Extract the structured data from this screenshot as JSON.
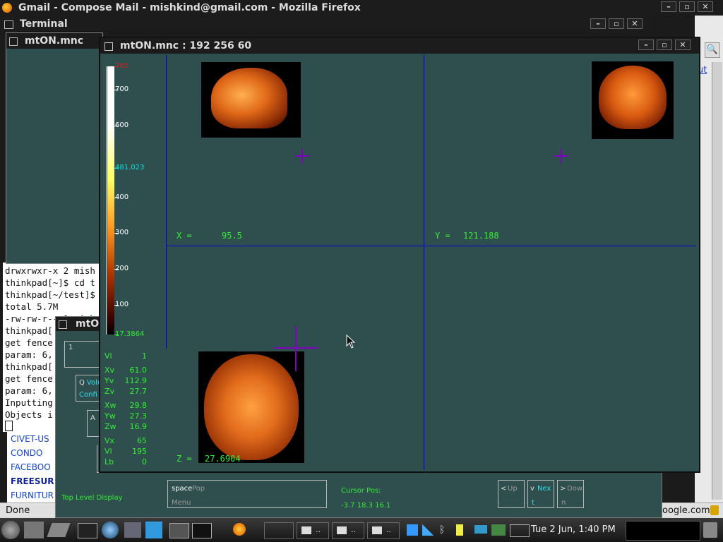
{
  "firefox": {
    "title": "Gmail - Compose Mail - mishkind@gmail.com - Mozilla Firefox",
    "status": "Done",
    "status_right": "oogle.com",
    "link_right": "ut",
    "bookmarks": [
      "CIVET-US",
      "CONDO",
      "FACEBOO",
      "FREESUR",
      "FURNITUR"
    ]
  },
  "terminal": {
    "title": "Terminal",
    "lines": [
      "drwxrwxr-x 2 mish",
      "thinkpad[~]$ cd t",
      "thinkpad[~/test]$",
      "total 5.7M",
      "-rw-rw-r-- 1 mish",
      "thinkpad[",
      "get fence",
      "param: 6,",
      "thinkpad[",
      "get fence",
      "param: 6,",
      "Inputting",
      "Objects i"
    ]
  },
  "mtonsmall": {
    "title": "mtON.mnc"
  },
  "mtonmenu": {
    "title": "mtO",
    "field1": "1",
    "btn_q": "Q",
    "btn_q_label": "Volu",
    "btn_conf": "Confi",
    "btn_a": "A",
    "status_label": "Top Level Display",
    "space_key": "space",
    "space_label": "Pop",
    "space_sub": "Menu",
    "cursor_label": "Cursor Pos:",
    "cursor_value": "-3.7 18.3 16.1",
    "up_key": "<",
    "up_label": "Up",
    "next_key": "v",
    "next_label": "Nex",
    "next_sub": "t",
    "down_key": ">",
    "down_label": "Dow",
    "down_sub": "n"
  },
  "viewer": {
    "title": "mtON.mnc : 192 256 60",
    "colorbar": {
      "labels": [
        "765",
        "700",
        "600",
        "481.023",
        "400",
        "300",
        "200",
        "100",
        "17.3864"
      ],
      "values": [
        765,
        700,
        600,
        481.023,
        400,
        300,
        200,
        100,
        17.3864
      ],
      "range": [
        17.3864,
        765
      ],
      "colors": [
        "#cc2222",
        "#ffffff",
        "#ffffff",
        "#00e5e5",
        "#ffffff",
        "#ffffff",
        "#ffffff",
        "#ffffff",
        "#33ee33"
      ]
    },
    "x_label": "X =",
    "x_value": "95.5",
    "y_label": "Y =",
    "y_value": "121.188",
    "z_label": "Z =",
    "z_value": "27.6904",
    "info": [
      {
        "k": "Vl",
        "v": "1"
      },
      {
        "k": "Xv",
        "v": "61.0"
      },
      {
        "k": "Yv",
        "v": "112.9"
      },
      {
        "k": "Zv",
        "v": "27.7"
      },
      {
        "k": "Xw",
        "v": "29.8"
      },
      {
        "k": "Yw",
        "v": "27.3"
      },
      {
        "k": "Zw",
        "v": "16.9"
      },
      {
        "k": "Vx",
        "v": "65"
      },
      {
        "k": "Vl",
        "v": "195"
      },
      {
        "k": "Lb",
        "v": "0"
      }
    ]
  },
  "taskbar": {
    "clock": "Tue  2 Jun,  1:40 PM",
    "task_labels": [
      "..",
      "..",
      ".."
    ]
  }
}
